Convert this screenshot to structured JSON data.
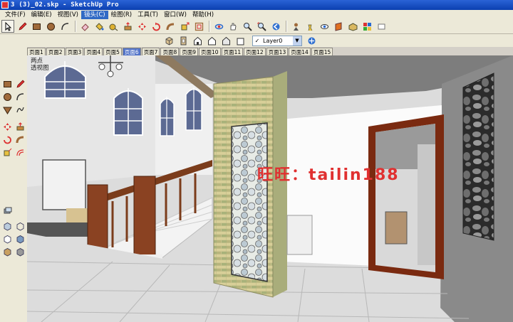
{
  "window": {
    "title": "3 (3)_02.skp - SketchUp Pro"
  },
  "menubar": {
    "items": [
      {
        "label": "文件(F)"
      },
      {
        "label": "编辑(E)"
      },
      {
        "label": "视图(V)"
      },
      {
        "label": "镜头(C)"
      },
      {
        "label": "绘图(R)"
      },
      {
        "label": "工具(T)"
      },
      {
        "label": "窗口(W)"
      },
      {
        "label": "帮助(H)"
      }
    ],
    "active_index": 3
  },
  "toolbar": {
    "layer": {
      "name": "Layer0",
      "visible": true
    }
  },
  "scene_tabs": {
    "items": [
      "页面1",
      "页面2",
      "页面3",
      "页面4",
      "页面5",
      "页面6",
      "页面7",
      "页面8",
      "页面9",
      "页面10",
      "页面11",
      "页面12",
      "页面13",
      "页面14",
      "页面15"
    ],
    "active_index": 5
  },
  "viewport": {
    "label_line1": "两点",
    "label_line2": "透视图",
    "watermark": "旺旺：tailin188"
  },
  "colors": {
    "titlebar": "#0b3fb0",
    "menu_active": "#316ac5",
    "tab_active": "#5273c8",
    "watermark": "#e03030",
    "door_frame": "#7a2a10"
  },
  "icons": {
    "toolbar1": [
      "select-icon",
      "pencil-icon",
      "rectangle-icon",
      "circle-icon",
      "arc-icon",
      "eraser-icon",
      "paint-bucket-icon",
      "tape-measure-icon",
      "push-pull-icon",
      "move-icon",
      "rotate-icon",
      "follow-me-icon",
      "scale-icon",
      "offset-icon",
      "orbit-icon",
      "pan-icon",
      "zoom-icon",
      "zoom-extents-icon",
      "previous-view-icon",
      "position-camera-icon",
      "walk-icon",
      "look-around-icon",
      "section-plane-icon",
      "component-icon",
      "material-icon",
      "hide-icon"
    ],
    "toolbar2": [
      "iso-view-icon",
      "top-view-icon",
      "front-view-icon",
      "right-view-icon",
      "back-view-icon",
      "left-view-icon"
    ]
  }
}
